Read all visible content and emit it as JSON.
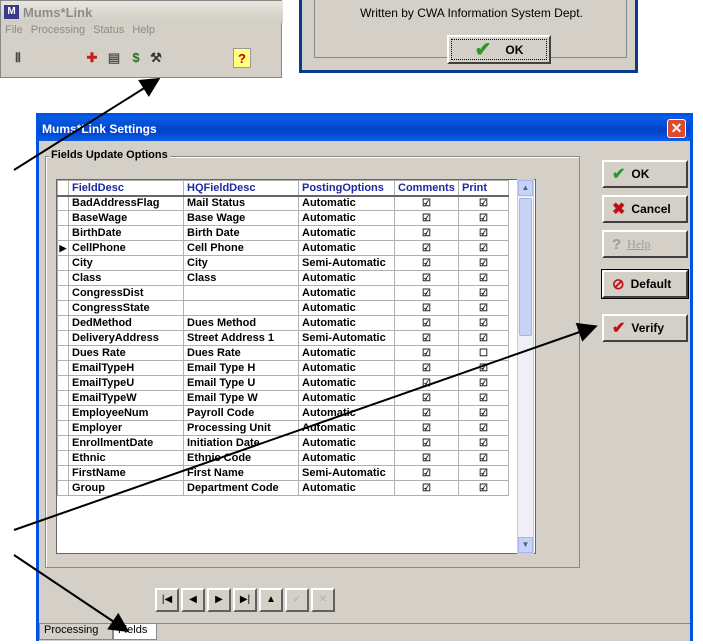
{
  "app": {
    "title": "Mums*Link",
    "menu": [
      "File",
      "Processing",
      "Status",
      "Help"
    ],
    "toolbar_icons": [
      "exit-door-icon",
      "transfer-icon",
      "document-icon",
      "dollar-icon",
      "settings-tools-icon",
      "help-icon"
    ]
  },
  "about": {
    "text": "Written by CWA Information System Dept.",
    "ok_label": "OK"
  },
  "settings": {
    "title": "Mums*Link Settings",
    "close_label": "✕",
    "group_label": "Fields Update Options",
    "columns": [
      "FieldDesc",
      "HQFieldDesc",
      "PostingOptions",
      "Comments",
      "Print"
    ],
    "rows": [
      [
        "BadAddressFlag",
        "Mail Status",
        "Automatic",
        true,
        true
      ],
      [
        "BaseWage",
        "Base Wage",
        "Automatic",
        true,
        true
      ],
      [
        "BirthDate",
        "Birth Date",
        "Automatic",
        true,
        true
      ],
      [
        "CellPhone",
        "Cell Phone",
        "Automatic",
        true,
        true
      ],
      [
        "City",
        "City",
        "Semi-Automatic",
        true,
        true
      ],
      [
        "Class",
        "Class",
        "Automatic",
        true,
        true
      ],
      [
        "CongressDist",
        "",
        "Automatic",
        true,
        true
      ],
      [
        "CongressState",
        "",
        "Automatic",
        true,
        true
      ],
      [
        "DedMethod",
        "Dues Method",
        "Automatic",
        true,
        true
      ],
      [
        "DeliveryAddress",
        "Street Address 1",
        "Semi-Automatic",
        true,
        true
      ],
      [
        "Dues Rate",
        "Dues Rate",
        "Automatic",
        true,
        false
      ],
      [
        "EmailTypeH",
        "Email Type H",
        "Automatic",
        true,
        true
      ],
      [
        "EmailTypeU",
        "Email Type U",
        "Automatic",
        true,
        true
      ],
      [
        "EmailTypeW",
        "Email Type W",
        "Automatic",
        true,
        true
      ],
      [
        "EmployeeNum",
        "Payroll Code",
        "Automatic",
        true,
        true
      ],
      [
        "Employer",
        "Processing Unit",
        "Automatic",
        true,
        true
      ],
      [
        "EnrollmentDate",
        "Initiation Date",
        "Automatic",
        true,
        true
      ],
      [
        "Ethnic",
        "Ethnic Code",
        "Automatic",
        true,
        true
      ],
      [
        "FirstName",
        "First Name",
        "Semi-Automatic",
        true,
        true
      ],
      [
        "Group",
        "Department Code",
        "Automatic",
        true,
        true
      ]
    ],
    "current_row": 3,
    "buttons": {
      "ok": "OK",
      "cancel": "Cancel",
      "help": "Help",
      "default": "Default",
      "verify": "Verify"
    },
    "nav_buttons": [
      "|◀",
      "◀",
      "▶",
      "▶|",
      "▲",
      "✓",
      "✕"
    ],
    "tabs": [
      "Processing",
      "Fields"
    ],
    "active_tab": "Fields"
  },
  "colors": {
    "titlebar": "#0a5fe8",
    "header_text": "#1a2aa0",
    "ok_check": "#2a9a2a",
    "cancel_x": "#c01010"
  }
}
